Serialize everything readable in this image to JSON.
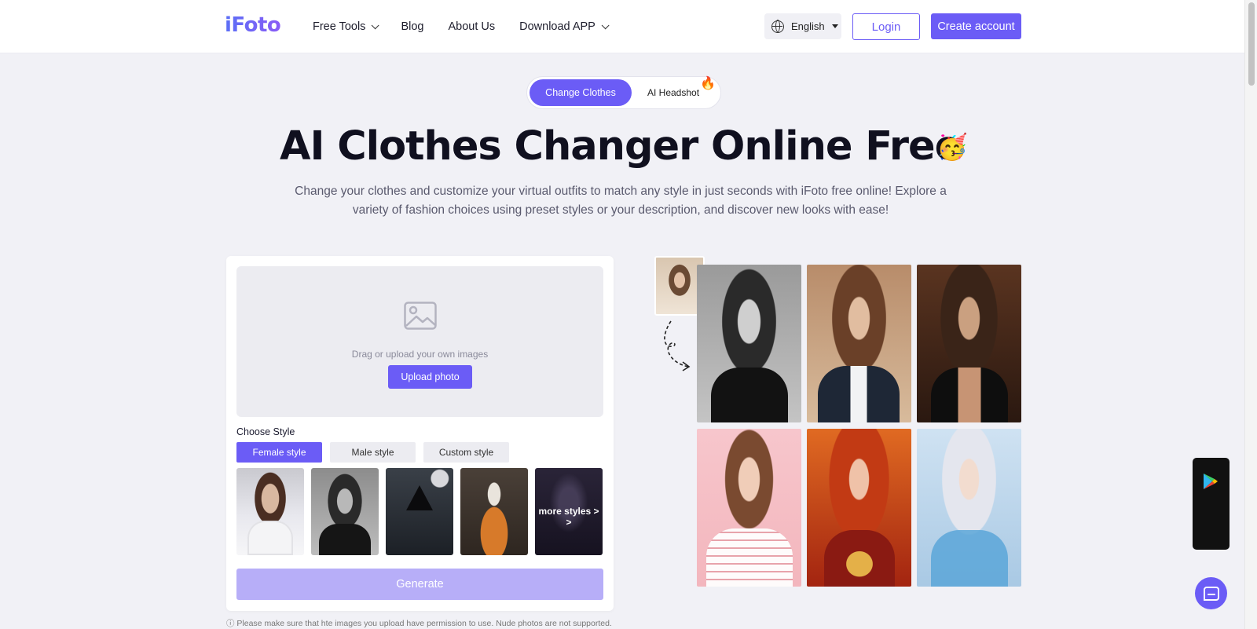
{
  "header": {
    "logo": "iFoto",
    "nav": [
      {
        "label": "Free Tools",
        "dropdown": true
      },
      {
        "label": "Blog",
        "dropdown": false
      },
      {
        "label": "About Us",
        "dropdown": false
      },
      {
        "label": "Download APP",
        "dropdown": true
      }
    ],
    "language": "English",
    "login_label": "Login",
    "create_label": "Create account"
  },
  "hero": {
    "tabs": [
      "Change Clothes",
      "AI Headshot"
    ],
    "title": "AI Clothes Changer Online Free",
    "subtitle": "Change your clothes and customize your virtual outfits to match any style in just seconds with iFoto free online! Explore a variety of fashion choices using preset styles or your description, and discover new looks with ease!"
  },
  "upload": {
    "drop_text": "Drag or upload your own images",
    "upload_label": "Upload photo",
    "choose_label": "Choose Style",
    "style_tabs": [
      "Female style",
      "Male style",
      "Custom style"
    ],
    "active_style_tab": "Female style",
    "more_styles": "more styles > >",
    "generate_label": "Generate",
    "disclaimer": "ⓘ  Please make sure that hte images you upload have permission to use. Nude photos are not supported."
  },
  "colors": {
    "accent": "#6b5cf6",
    "generate_disabled": "#b7aef8",
    "background": "#f1f1f6"
  },
  "icons": [
    "globe-icon",
    "image-icon",
    "google-play-icon",
    "apple-icon",
    "chat-icon",
    "fire-icon",
    "party-face-emoji"
  ]
}
